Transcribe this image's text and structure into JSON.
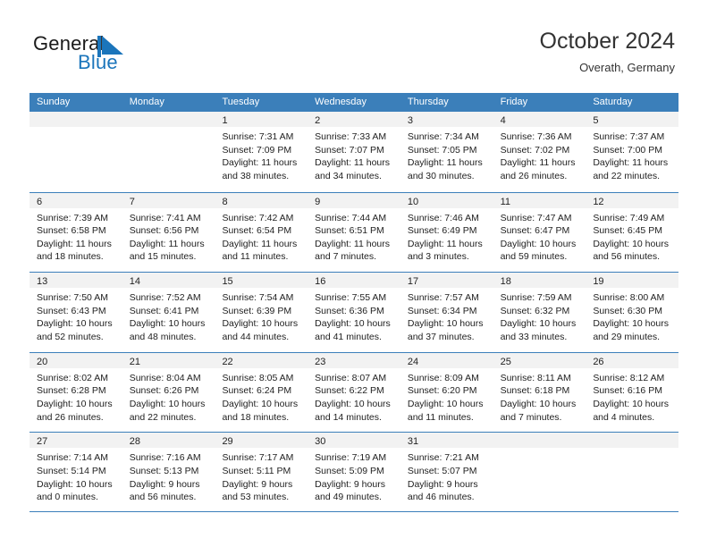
{
  "brand": {
    "name_part1": "General",
    "name_part2": "Blue",
    "flag_icon": "blue-flag-triangle",
    "accent_color": "#1b75bb"
  },
  "header": {
    "title": "October 2024",
    "subtitle": "Overath, Germany"
  },
  "theme": {
    "header_row_color": "#3b7fba",
    "daynum_strip_color": "#f2f2f2",
    "cell_background": "#ffffff",
    "text_color": "#222222"
  },
  "weekdays": [
    "Sunday",
    "Monday",
    "Tuesday",
    "Wednesday",
    "Thursday",
    "Friday",
    "Saturday"
  ],
  "weeks": [
    [
      {
        "day": "",
        "lines": []
      },
      {
        "day": "",
        "lines": []
      },
      {
        "day": "1",
        "lines": [
          "Sunrise: 7:31 AM",
          "Sunset: 7:09 PM",
          "Daylight: 11 hours",
          "and 38 minutes."
        ]
      },
      {
        "day": "2",
        "lines": [
          "Sunrise: 7:33 AM",
          "Sunset: 7:07 PM",
          "Daylight: 11 hours",
          "and 34 minutes."
        ]
      },
      {
        "day": "3",
        "lines": [
          "Sunrise: 7:34 AM",
          "Sunset: 7:05 PM",
          "Daylight: 11 hours",
          "and 30 minutes."
        ]
      },
      {
        "day": "4",
        "lines": [
          "Sunrise: 7:36 AM",
          "Sunset: 7:02 PM",
          "Daylight: 11 hours",
          "and 26 minutes."
        ]
      },
      {
        "day": "5",
        "lines": [
          "Sunrise: 7:37 AM",
          "Sunset: 7:00 PM",
          "Daylight: 11 hours",
          "and 22 minutes."
        ]
      }
    ],
    [
      {
        "day": "6",
        "lines": [
          "Sunrise: 7:39 AM",
          "Sunset: 6:58 PM",
          "Daylight: 11 hours",
          "and 18 minutes."
        ]
      },
      {
        "day": "7",
        "lines": [
          "Sunrise: 7:41 AM",
          "Sunset: 6:56 PM",
          "Daylight: 11 hours",
          "and 15 minutes."
        ]
      },
      {
        "day": "8",
        "lines": [
          "Sunrise: 7:42 AM",
          "Sunset: 6:54 PM",
          "Daylight: 11 hours",
          "and 11 minutes."
        ]
      },
      {
        "day": "9",
        "lines": [
          "Sunrise: 7:44 AM",
          "Sunset: 6:51 PM",
          "Daylight: 11 hours",
          "and 7 minutes."
        ]
      },
      {
        "day": "10",
        "lines": [
          "Sunrise: 7:46 AM",
          "Sunset: 6:49 PM",
          "Daylight: 11 hours",
          "and 3 minutes."
        ]
      },
      {
        "day": "11",
        "lines": [
          "Sunrise: 7:47 AM",
          "Sunset: 6:47 PM",
          "Daylight: 10 hours",
          "and 59 minutes."
        ]
      },
      {
        "day": "12",
        "lines": [
          "Sunrise: 7:49 AM",
          "Sunset: 6:45 PM",
          "Daylight: 10 hours",
          "and 56 minutes."
        ]
      }
    ],
    [
      {
        "day": "13",
        "lines": [
          "Sunrise: 7:50 AM",
          "Sunset: 6:43 PM",
          "Daylight: 10 hours",
          "and 52 minutes."
        ]
      },
      {
        "day": "14",
        "lines": [
          "Sunrise: 7:52 AM",
          "Sunset: 6:41 PM",
          "Daylight: 10 hours",
          "and 48 minutes."
        ]
      },
      {
        "day": "15",
        "lines": [
          "Sunrise: 7:54 AM",
          "Sunset: 6:39 PM",
          "Daylight: 10 hours",
          "and 44 minutes."
        ]
      },
      {
        "day": "16",
        "lines": [
          "Sunrise: 7:55 AM",
          "Sunset: 6:36 PM",
          "Daylight: 10 hours",
          "and 41 minutes."
        ]
      },
      {
        "day": "17",
        "lines": [
          "Sunrise: 7:57 AM",
          "Sunset: 6:34 PM",
          "Daylight: 10 hours",
          "and 37 minutes."
        ]
      },
      {
        "day": "18",
        "lines": [
          "Sunrise: 7:59 AM",
          "Sunset: 6:32 PM",
          "Daylight: 10 hours",
          "and 33 minutes."
        ]
      },
      {
        "day": "19",
        "lines": [
          "Sunrise: 8:00 AM",
          "Sunset: 6:30 PM",
          "Daylight: 10 hours",
          "and 29 minutes."
        ]
      }
    ],
    [
      {
        "day": "20",
        "lines": [
          "Sunrise: 8:02 AM",
          "Sunset: 6:28 PM",
          "Daylight: 10 hours",
          "and 26 minutes."
        ]
      },
      {
        "day": "21",
        "lines": [
          "Sunrise: 8:04 AM",
          "Sunset: 6:26 PM",
          "Daylight: 10 hours",
          "and 22 minutes."
        ]
      },
      {
        "day": "22",
        "lines": [
          "Sunrise: 8:05 AM",
          "Sunset: 6:24 PM",
          "Daylight: 10 hours",
          "and 18 minutes."
        ]
      },
      {
        "day": "23",
        "lines": [
          "Sunrise: 8:07 AM",
          "Sunset: 6:22 PM",
          "Daylight: 10 hours",
          "and 14 minutes."
        ]
      },
      {
        "day": "24",
        "lines": [
          "Sunrise: 8:09 AM",
          "Sunset: 6:20 PM",
          "Daylight: 10 hours",
          "and 11 minutes."
        ]
      },
      {
        "day": "25",
        "lines": [
          "Sunrise: 8:11 AM",
          "Sunset: 6:18 PM",
          "Daylight: 10 hours",
          "and 7 minutes."
        ]
      },
      {
        "day": "26",
        "lines": [
          "Sunrise: 8:12 AM",
          "Sunset: 6:16 PM",
          "Daylight: 10 hours",
          "and 4 minutes."
        ]
      }
    ],
    [
      {
        "day": "27",
        "lines": [
          "Sunrise: 7:14 AM",
          "Sunset: 5:14 PM",
          "Daylight: 10 hours",
          "and 0 minutes."
        ]
      },
      {
        "day": "28",
        "lines": [
          "Sunrise: 7:16 AM",
          "Sunset: 5:13 PM",
          "Daylight: 9 hours",
          "and 56 minutes."
        ]
      },
      {
        "day": "29",
        "lines": [
          "Sunrise: 7:17 AM",
          "Sunset: 5:11 PM",
          "Daylight: 9 hours",
          "and 53 minutes."
        ]
      },
      {
        "day": "30",
        "lines": [
          "Sunrise: 7:19 AM",
          "Sunset: 5:09 PM",
          "Daylight: 9 hours",
          "and 49 minutes."
        ]
      },
      {
        "day": "31",
        "lines": [
          "Sunrise: 7:21 AM",
          "Sunset: 5:07 PM",
          "Daylight: 9 hours",
          "and 46 minutes."
        ]
      },
      {
        "day": "",
        "lines": []
      },
      {
        "day": "",
        "lines": []
      }
    ]
  ]
}
